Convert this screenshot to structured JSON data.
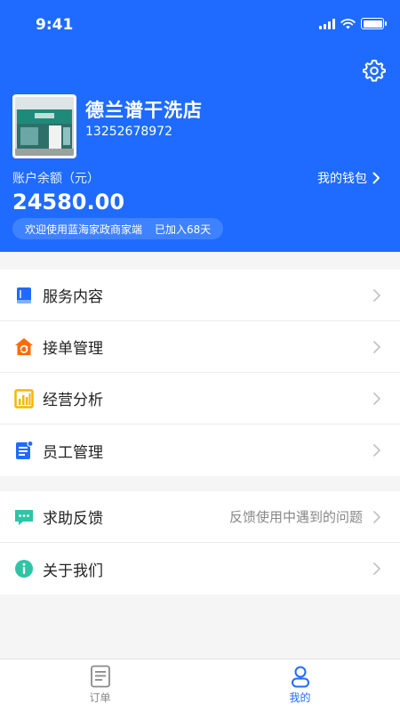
{
  "status_bar": {
    "time": "9:41"
  },
  "profile": {
    "store_name": "德兰谱干洗店",
    "phone": "13252678972",
    "balance_label": "账户余额（元）",
    "balance": "24580.00",
    "wallet_label": "我的钱包",
    "welcome_text": "欢迎使用蓝海家政商家端",
    "joined_text": "已加入68天"
  },
  "menu_group_1": [
    {
      "label": "服务内容",
      "icon": "book-icon",
      "color": "#1f6bff"
    },
    {
      "label": "接单管理",
      "icon": "house-refresh-icon",
      "color": "#ff6a00"
    },
    {
      "label": "经营分析",
      "icon": "bar-chart-icon",
      "color": "#f5b800"
    },
    {
      "label": "员工管理",
      "icon": "staff-doc-icon",
      "color": "#1f6bff"
    }
  ],
  "menu_group_2": [
    {
      "label": "求助反馈",
      "icon": "chat-icon",
      "hint": "反馈使用中遇到的问题",
      "color": "#2ec4a6"
    },
    {
      "label": "关于我们",
      "icon": "info-icon",
      "color": "#2ec4a6"
    }
  ],
  "tabbar": {
    "tabs": [
      {
        "label": "订单",
        "icon": "order-icon",
        "active": false
      },
      {
        "label": "我的",
        "icon": "person-icon",
        "active": true
      }
    ]
  },
  "colors": {
    "brand": "#1f6bff",
    "background": "#f5f5f5"
  }
}
